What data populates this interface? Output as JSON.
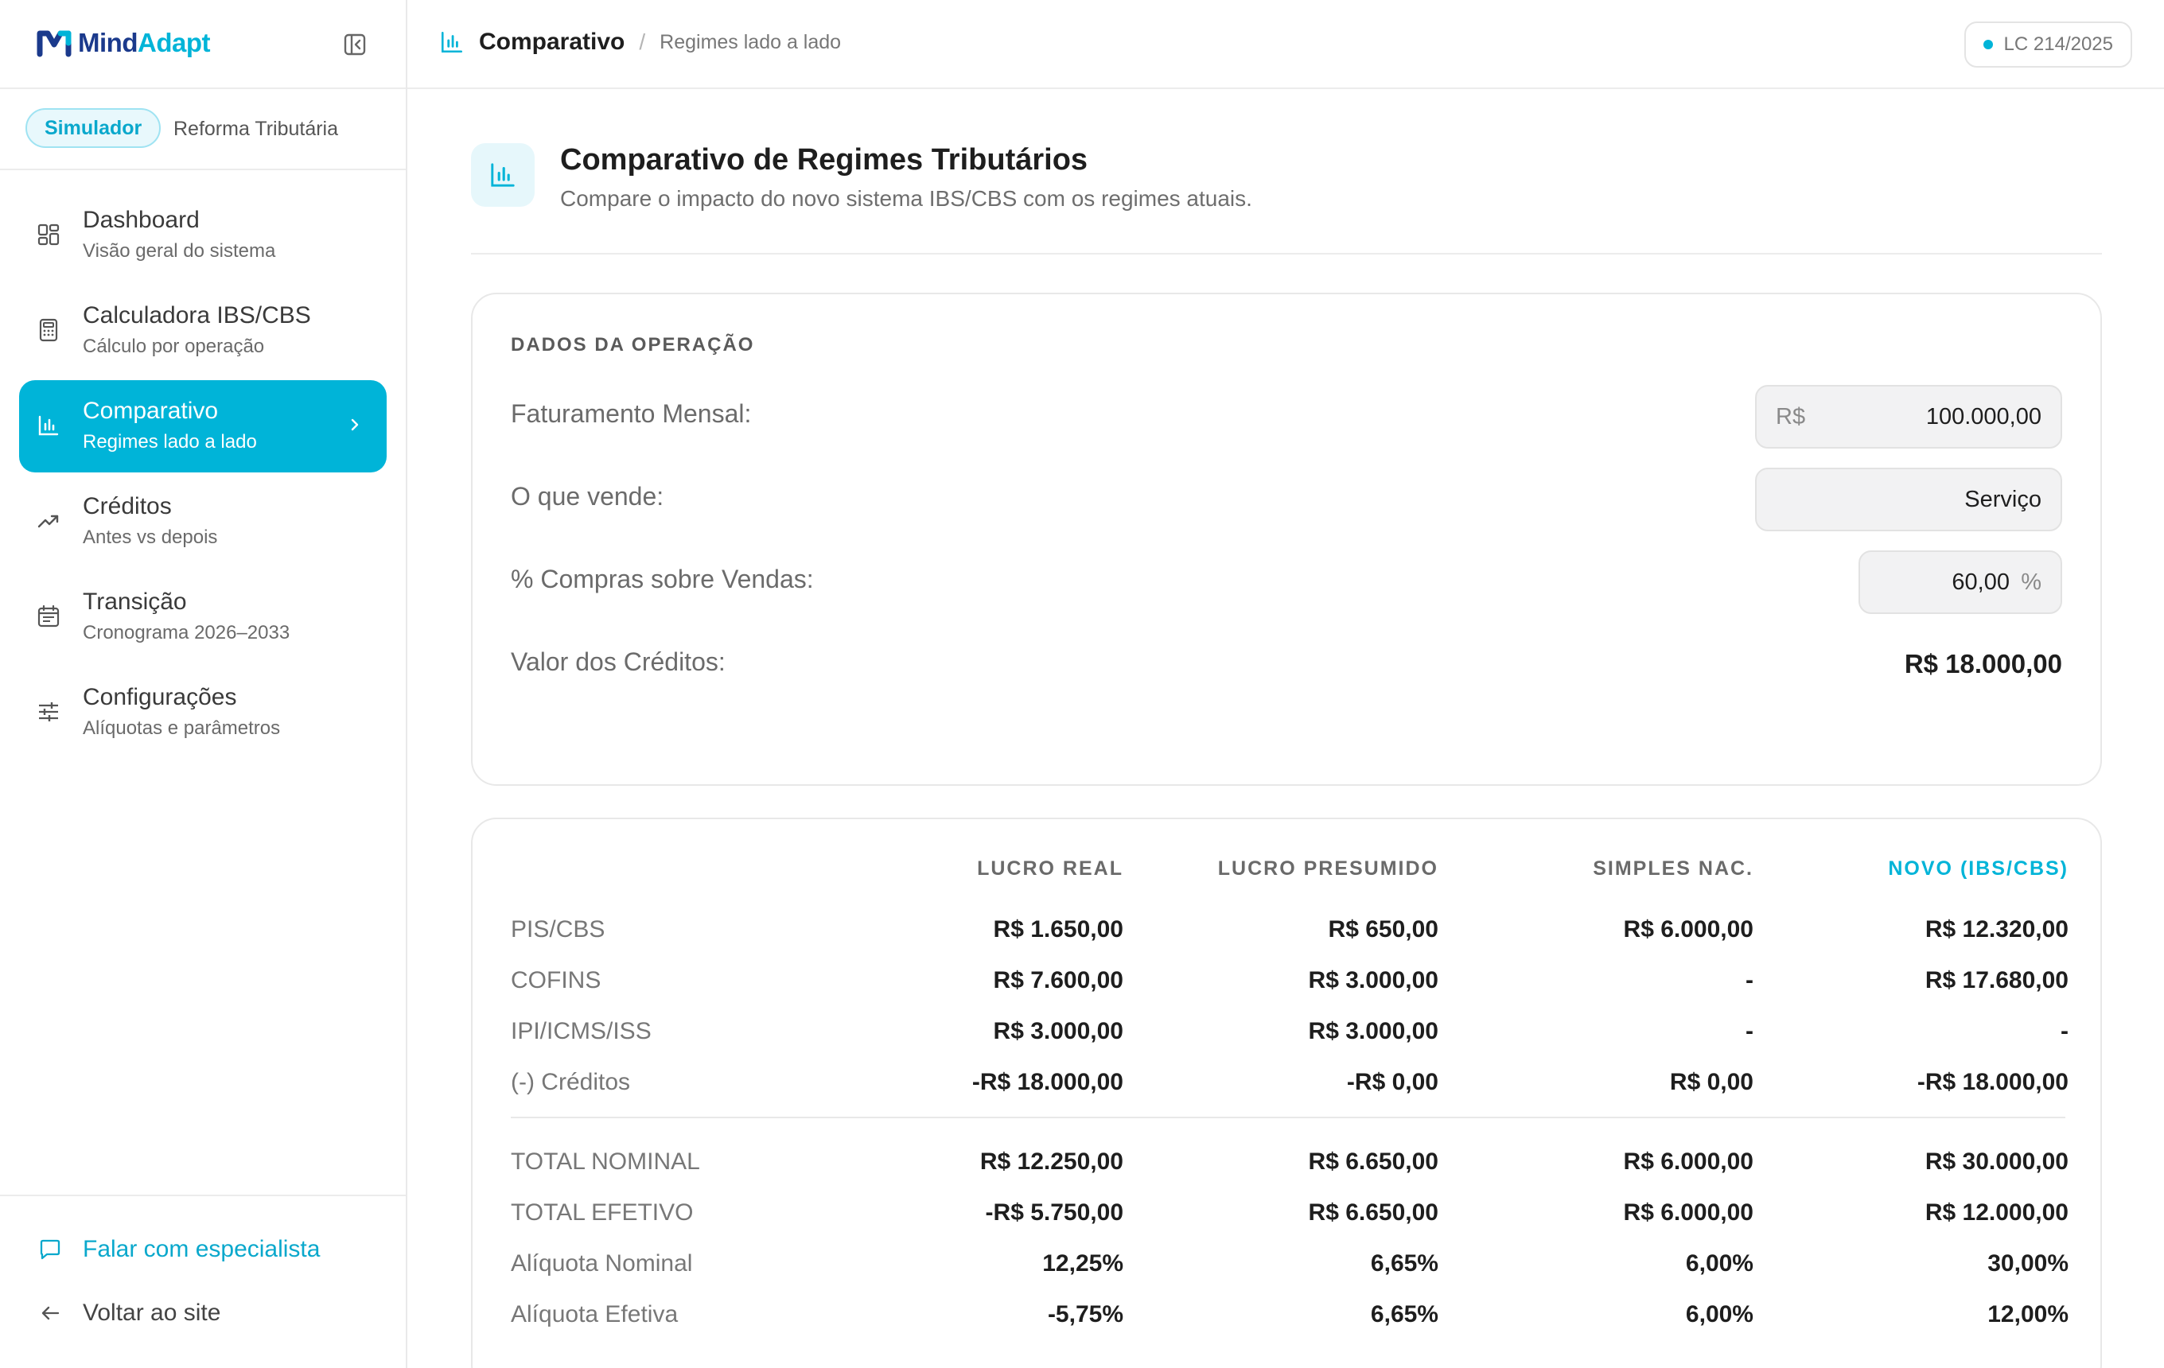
{
  "brand": {
    "name_part1": "Mind",
    "name_part2": "Adapt"
  },
  "mode": {
    "active_pill": "Simulador",
    "label": "Reforma Tributária"
  },
  "sidebar": {
    "items": [
      {
        "title": "Dashboard",
        "subtitle": "Visão geral do sistema",
        "icon": "dashboard-grid-icon"
      },
      {
        "title": "Calculadora IBS/CBS",
        "subtitle": "Cálculo por operação",
        "icon": "calculator-icon"
      },
      {
        "title": "Comparativo",
        "subtitle": "Regimes lado a lado",
        "icon": "bar-chart-icon",
        "active": true
      },
      {
        "title": "Créditos",
        "subtitle": "Antes vs depois",
        "icon": "trending-up-icon"
      },
      {
        "title": "Transição",
        "subtitle": "Cronograma 2026–2033",
        "icon": "calendar-icon"
      },
      {
        "title": "Configurações",
        "subtitle": "Alíquotas e parâmetros",
        "icon": "sliders-icon"
      }
    ],
    "footer": {
      "specialist": "Falar com especialista",
      "back": "Voltar ao site"
    }
  },
  "header": {
    "breadcrumb_current": "Comparativo",
    "breadcrumb_separator": "/",
    "breadcrumb_sub": "Regimes lado a lado",
    "badge": "LC 214/2025"
  },
  "page": {
    "title": "Comparativo de Regimes Tributários",
    "subtitle": "Compare o impacto do novo sistema IBS/CBS com os regimes atuais."
  },
  "operation": {
    "section_label": "DADOS DA OPERAÇÃO",
    "revenue_label": "Faturamento Mensal:",
    "revenue_prefix": "R$",
    "revenue_value": "100.000,00",
    "sells_label": "O que vende:",
    "sells_value": "Serviço",
    "purchases_label": "% Compras sobre Vendas:",
    "purchases_value": "60,00",
    "purchases_suffix": "%",
    "credits_label": "Valor dos Créditos:",
    "credits_value": "R$ 18.000,00"
  },
  "table": {
    "headers": [
      "LUCRO REAL",
      "LUCRO PRESUMIDO",
      "SIMPLES NAC.",
      "NOVO (IBS/CBS)"
    ],
    "rows": [
      {
        "label": "PIS/CBS",
        "values": [
          "R$ 1.650,00",
          "R$ 650,00",
          "R$ 6.000,00",
          "R$ 12.320,00"
        ]
      },
      {
        "label": "COFINS",
        "values": [
          "R$ 7.600,00",
          "R$ 3.000,00",
          "-",
          "R$ 17.680,00"
        ]
      },
      {
        "label": "IPI/ICMS/ISS",
        "values": [
          "R$ 3.000,00",
          "R$ 3.000,00",
          "-",
          "-"
        ]
      },
      {
        "label": "(-) Créditos",
        "values": [
          "-R$ 18.000,00",
          "-R$ 0,00",
          "R$ 0,00",
          "-R$ 18.000,00"
        ]
      }
    ],
    "totals": [
      {
        "label": "TOTAL NOMINAL",
        "values": [
          "R$ 12.250,00",
          "R$ 6.650,00",
          "R$ 6.000,00",
          "R$ 30.000,00"
        ]
      },
      {
        "label": "TOTAL EFETIVO",
        "values": [
          "-R$ 5.750,00",
          "R$ 6.650,00",
          "R$ 6.000,00",
          "R$ 12.000,00"
        ]
      },
      {
        "label": "Alíquota Nominal",
        "values": [
          "12,25%",
          "6,65%",
          "6,00%",
          "30,00%"
        ]
      },
      {
        "label": "Alíquota Efetiva",
        "values": [
          "-5,75%",
          "6,65%",
          "6,00%",
          "12,00%"
        ]
      }
    ]
  },
  "colors": {
    "accent": "#00b4d8",
    "brand_dark": "#1b3a8c"
  }
}
